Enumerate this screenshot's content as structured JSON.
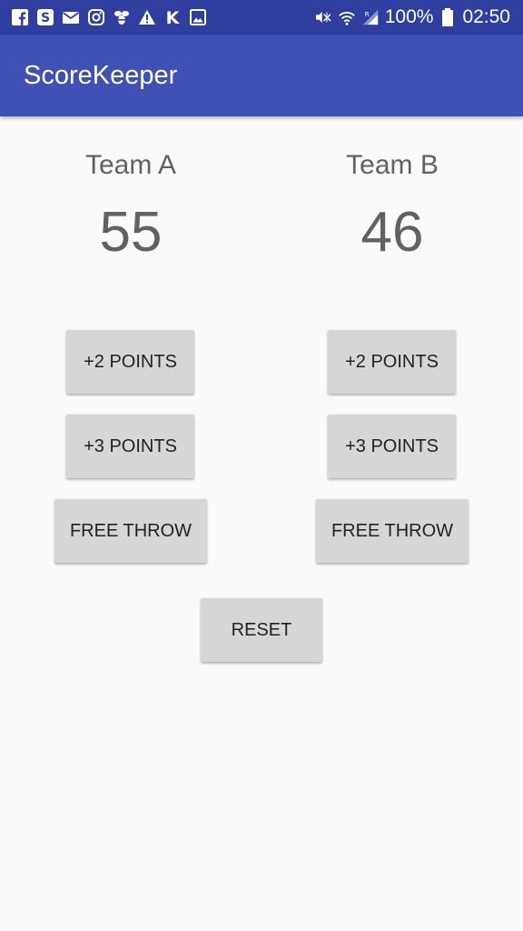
{
  "status_bar": {
    "icons": [
      "facebook-icon",
      "skype-icon",
      "mail-icon",
      "instagram-icon",
      "bee-icon",
      "alert-icon",
      "k-icon",
      "image-icon"
    ],
    "battery_percent": "100%",
    "time": "02:50"
  },
  "app": {
    "title": "ScoreKeeper"
  },
  "team_a": {
    "name": "Team A",
    "score": "55",
    "plus_two_label": "+2 POINTS",
    "plus_three_label": "+3 POINTS",
    "free_throw_label": "FREE THROW"
  },
  "team_b": {
    "name": "Team B",
    "score": "46",
    "plus_two_label": "+2 POINTS",
    "plus_three_label": "+3 POINTS",
    "free_throw_label": "FREE THROW"
  },
  "reset_label": "RESET",
  "colors": {
    "status_bar": "#303f9f",
    "app_bar": "#3f51b5",
    "button": "#d6d6d6",
    "text_secondary": "#616161"
  }
}
